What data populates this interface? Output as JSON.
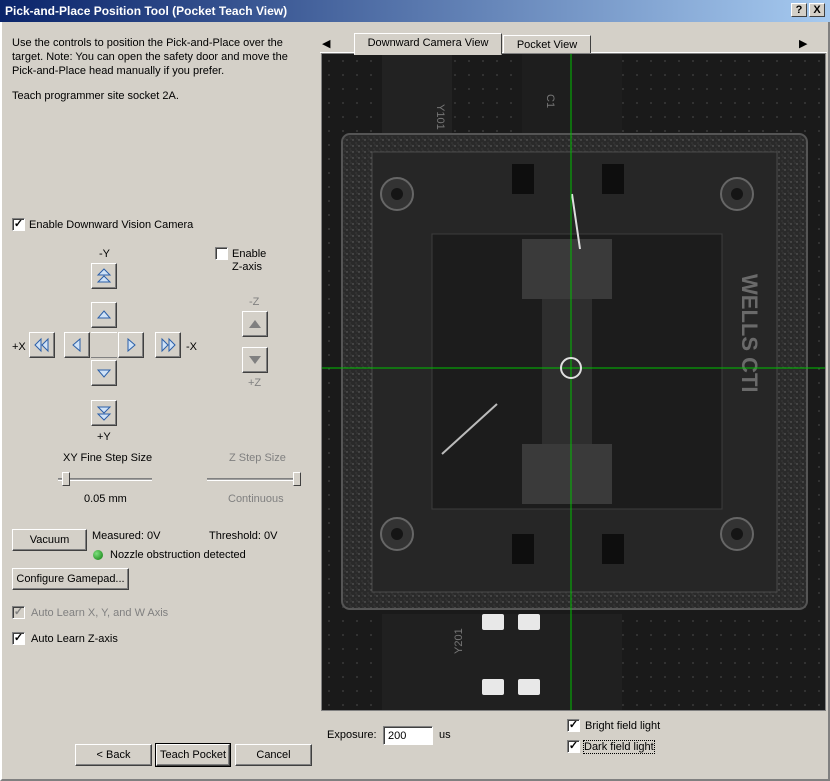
{
  "window": {
    "title": "Pick-and-Place Position Tool (Pocket Teach View)",
    "help_label": "?",
    "close_label": "X"
  },
  "instructions": {
    "line1": "Use the controls to position the Pick-and-Place over the",
    "line2": "target.  Note:  You can open the safety door and move the",
    "line3": "Pick-and-Place head manually if you prefer.",
    "site": "Teach programmer site socket 2A."
  },
  "camera_toggle": {
    "label": "Enable Downward Vision Camera",
    "checked": true,
    "mark": "✓"
  },
  "jog": {
    "minus_y": "-Y",
    "plus_y": "+Y",
    "plus_x": "+X",
    "minus_x": "-X"
  },
  "z_axis": {
    "enable_line1": "Enable",
    "enable_line2": "Z-axis",
    "minus_z": "-Z",
    "plus_z": "+Z",
    "checked": false
  },
  "xy_step": {
    "label": "XY Fine Step Size",
    "value": "0.05 mm",
    "level": 0.05
  },
  "z_step": {
    "label": "Z Step Size",
    "value": "Continuous",
    "level": 1.0
  },
  "vacuum": {
    "button": "Vacuum",
    "measured": "Measured: 0V",
    "threshold": "Threshold: 0V",
    "status": "Nozzle obstruction detected"
  },
  "gamepad": {
    "button": "Configure Gamepad..."
  },
  "auto_learn_xyw": {
    "label": "Auto Learn X, Y, and W Axis",
    "checked": true,
    "disabled": true,
    "mark": "✓"
  },
  "auto_learn_z": {
    "label": "Auto Learn Z-axis",
    "checked": true,
    "mark": "✓"
  },
  "buttons": {
    "back": "< Back",
    "teach": "Teach Pocket",
    "cancel": "Cancel"
  },
  "tabs": [
    {
      "label": "Downward Camera View",
      "active": true
    },
    {
      "label": "Pocket View",
      "active": false
    }
  ],
  "tab_scroll": {
    "left": "◀",
    "right": "▶"
  },
  "camera": {
    "marks": {
      "y101": "Y101",
      "c1": "C1",
      "y201": "Y201",
      "wells": "WELLS CTI"
    },
    "crosshair_color": "#00c000"
  },
  "exposure": {
    "label": "Exposure:",
    "value": "200",
    "unit": "us"
  },
  "lighting": {
    "bright": {
      "label": "Bright field light",
      "checked": true,
      "mark": "✓"
    },
    "dark": {
      "label": "Dark field light",
      "checked": true,
      "mark": "✓"
    }
  }
}
